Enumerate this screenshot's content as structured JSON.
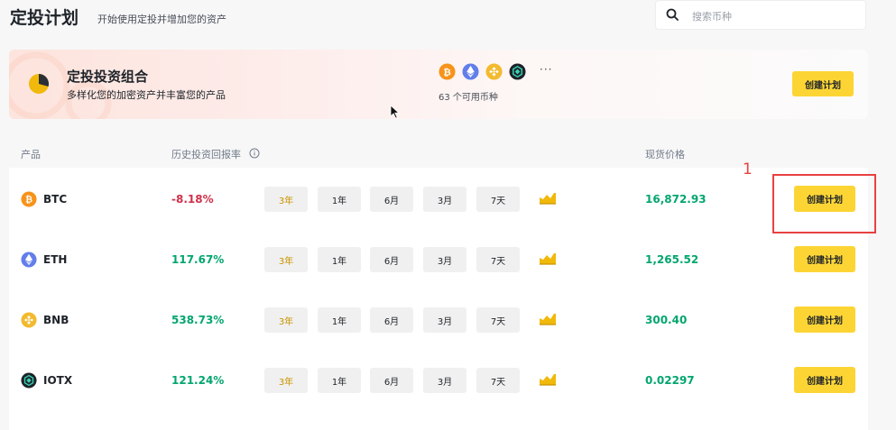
{
  "header": {
    "title": "定投计划",
    "subtitle": "开始使用定投并增加您的资产",
    "search_placeholder": "搜索币种"
  },
  "banner": {
    "title": "定投投资组合",
    "subtitle": "多样化您的加密资产并丰富您的产品",
    "coin_icons": [
      "btc-icon",
      "eth-icon",
      "bnb-icon",
      "iotx-icon"
    ],
    "more": "···",
    "count_text": "63 个可用币种",
    "create_label": "创建计划"
  },
  "table": {
    "headers": {
      "product": "产品",
      "roi": "历史投资回报率",
      "price": "现货价格"
    },
    "periods": [
      "3年",
      "1年",
      "6月",
      "3月",
      "7天"
    ],
    "create_label": "创建计划",
    "rows": [
      {
        "symbol": "BTC",
        "roi": "-8.18%",
        "roi_sign": "negative",
        "price": "16,872.93",
        "icon": "btc-icon",
        "color": "#f7931a"
      },
      {
        "symbol": "ETH",
        "roi": "117.67%",
        "roi_sign": "positive",
        "price": "1,265.52",
        "icon": "eth-icon",
        "color": "#627eea"
      },
      {
        "symbol": "BNB",
        "roi": "538.73%",
        "roi_sign": "positive",
        "price": "300.40",
        "icon": "bnb-icon",
        "color": "#f3ba2f"
      },
      {
        "symbol": "IOTX",
        "roi": "121.24%",
        "roi_sign": "positive",
        "price": "0.02297",
        "icon": "iotx-icon",
        "color": "#1e2329"
      }
    ]
  },
  "annotation": {
    "number": "1"
  },
  "colors": {
    "accent_yellow": "#fcd535",
    "positive": "#03a66d",
    "negative": "#cf304a",
    "active_period": "#c99400",
    "highlight": "#e84142"
  }
}
